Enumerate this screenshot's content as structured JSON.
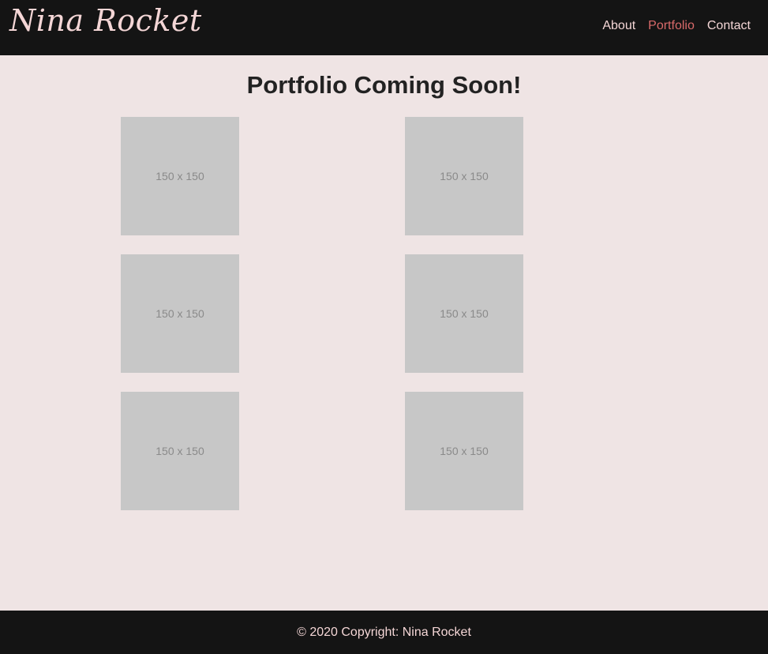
{
  "header": {
    "brand": "Nina Rocket",
    "nav": [
      {
        "label": "About",
        "active": false
      },
      {
        "label": "Portfolio",
        "active": true
      },
      {
        "label": "Contact",
        "active": false
      }
    ]
  },
  "main": {
    "title": "Portfolio Coming Soon!",
    "thumbnails": [
      {
        "label": "150 x 150"
      },
      {
        "label": "150 x 150"
      },
      {
        "label": "150 x 150"
      },
      {
        "label": "150 x 150"
      },
      {
        "label": "150 x 150"
      },
      {
        "label": "150 x 150"
      }
    ]
  },
  "footer": {
    "copyright": "© 2020 Copyright: Nina Rocket"
  },
  "colors": {
    "background": "#efe4e4",
    "navbar": "#141414",
    "accent": "#d96a6a",
    "nav_text": "#f4d6d6",
    "placeholder": "#c7c7c7"
  }
}
